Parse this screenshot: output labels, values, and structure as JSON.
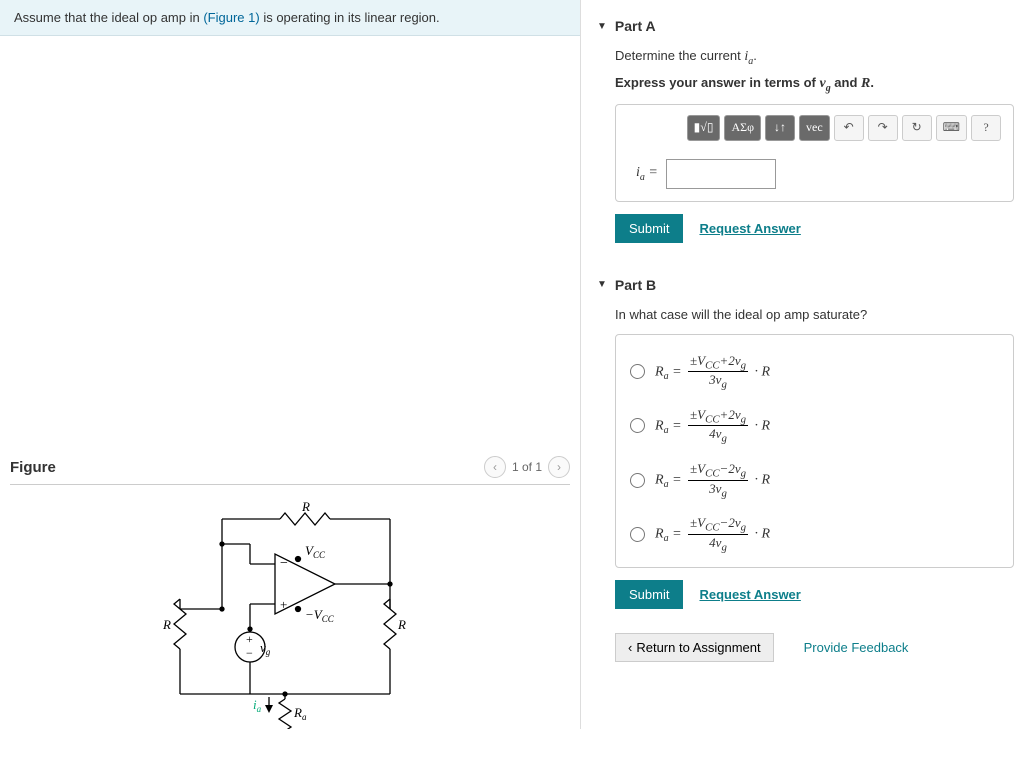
{
  "prompt": {
    "pre": "Assume that the ideal op amp in ",
    "link": "(Figure 1)",
    "post": " is operating in its linear region."
  },
  "figure": {
    "title": "Figure",
    "counter": "1 of 1",
    "labels": {
      "Rtop": "R",
      "Vccp": "V",
      "Vccp_sub": "CC",
      "Vccm": "−V",
      "Vccm_sub": "CC",
      "Rleft": "R",
      "Rright": "R",
      "vg": "v",
      "vg_sub": "g",
      "ia": "i",
      "ia_sub": "a",
      "Ra": "R",
      "Ra_sub": "a"
    }
  },
  "partA": {
    "title": "Part A",
    "line1_pre": "Determine the current ",
    "line1_var": "i",
    "line1_sub": "a",
    "line1_post": ".",
    "line2_pre": "Express your answer in terms of ",
    "line2_v1": "v",
    "line2_s1": "g",
    "line2_mid": " and ",
    "line2_v2": "R",
    "line2_post": ".",
    "toolbar": {
      "tpl": "▮√▯",
      "greek": "ΑΣφ",
      "updown": "↓↑",
      "vec": "vec",
      "undo": "↶",
      "redo": "↷",
      "reset": "↻",
      "kbd": "⌨",
      "help": "?"
    },
    "eq_lhs": "i",
    "eq_sub": "a",
    "eq_eq": " =",
    "submit": "Submit",
    "request": "Request Answer"
  },
  "partB": {
    "title": "Part B",
    "prompt": "In what case will the ideal op amp saturate?",
    "choices": [
      {
        "lhs": "R",
        "lhs_sub": "a",
        "num": "±V<sub>CC</sub>+2v<sub>g</sub>",
        "den": "3v<sub>g</sub>",
        "tail": " · R"
      },
      {
        "lhs": "R",
        "lhs_sub": "a",
        "num": "±V<sub>CC</sub>+2v<sub>g</sub>",
        "den": "4v<sub>g</sub>",
        "tail": " · R"
      },
      {
        "lhs": "R",
        "lhs_sub": "a",
        "num": "±V<sub>CC</sub>−2v<sub>g</sub>",
        "den": "3v<sub>g</sub>",
        "tail": " · R"
      },
      {
        "lhs": "R",
        "lhs_sub": "a",
        "num": "±V<sub>CC</sub>−2v<sub>g</sub>",
        "den": "4v<sub>g</sub>",
        "tail": " · R"
      }
    ],
    "submit": "Submit",
    "request": "Request Answer"
  },
  "footer": {
    "return": "Return to Assignment",
    "feedback": "Provide Feedback"
  }
}
